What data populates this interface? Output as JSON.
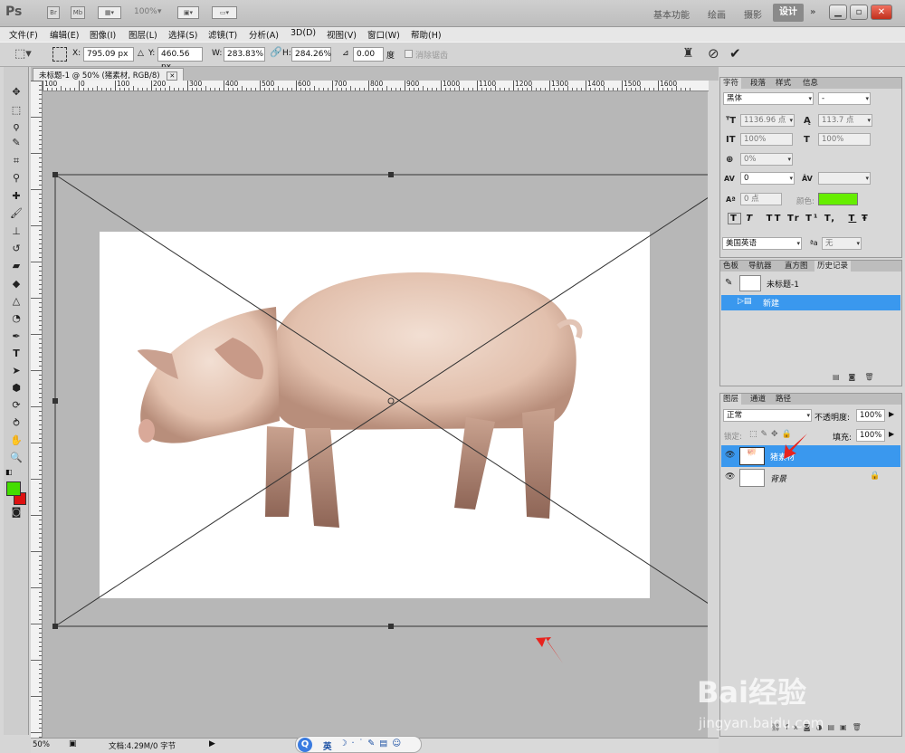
{
  "app": {
    "logo": "Ps",
    "zoom_display": "100%"
  },
  "workspaces": {
    "items": [
      "基本功能",
      "绘画",
      "摄影"
    ],
    "active": "设计",
    "more": "»"
  },
  "menu": [
    "文件(F)",
    "编辑(E)",
    "图像(I)",
    "图层(L)",
    "选择(S)",
    "滤镜(T)",
    "分析(A)",
    "3D(D)",
    "视图(V)",
    "窗口(W)",
    "帮助(H)"
  ],
  "options": {
    "x_label": "X:",
    "x_value": "795.09 px",
    "y_label": "Y:",
    "y_value": "460.56 px",
    "w_label": "W:",
    "w_value": "283.83%",
    "h_label": "H:",
    "h_value": "284.26%",
    "angle_value": "0.00",
    "angle_unit": "度",
    "antialias_label": "消除锯齿"
  },
  "document": {
    "tab_title": "未标题-1 @ 50% (猪素材, RGB/8)",
    "ruler_labels": [
      "100",
      "0",
      "100",
      "200",
      "300",
      "400",
      "500",
      "600",
      "700",
      "800",
      "900",
      "1000",
      "1100",
      "1200",
      "1300",
      "1400",
      "1500",
      "1600"
    ],
    "status_zoom": "50%",
    "status_info": "文档:4.29M/0 字节"
  },
  "character_panel": {
    "tabs": [
      "字符",
      "段落",
      "样式",
      "信息"
    ],
    "font_family": "黑体",
    "font_style": "-",
    "font_size": "1136.96 点",
    "leading": "113.7 点",
    "vertical_scale": "100%",
    "horizontal_scale": "100%",
    "kerning_percent": "0%",
    "tracking": "0",
    "baseline_shift": "0 点",
    "color_label": "颜色:",
    "color_value": "#66ee00",
    "language": "美国英语",
    "aa_label": "a",
    "aa_value": "无",
    "style_buttons": [
      "T",
      "T",
      "TT",
      "Tr",
      "T¹",
      "T,",
      "T",
      "Ŧ"
    ]
  },
  "history_panel": {
    "tabs": [
      "色板",
      "导航器",
      "直方图",
      "历史记录"
    ],
    "snapshot_label": "未标题-1",
    "items": [
      {
        "label": "新建",
        "selected": true
      }
    ]
  },
  "layers_panel": {
    "tabs": [
      "图层",
      "通道",
      "路径"
    ],
    "blend_mode": "正常",
    "opacity_label": "不透明度:",
    "opacity_value": "100%",
    "lock_label": "锁定:",
    "fill_label": "填充:",
    "fill_value": "100%",
    "layers": [
      {
        "name": "猪素材",
        "selected": true
      },
      {
        "name": "背景",
        "selected": false
      }
    ]
  },
  "colors": {
    "foreground": "#44dd00",
    "background": "#dd1111",
    "selection_blue": "#3a98ee",
    "annotation_red": "#e8231e"
  },
  "taskbar": {
    "ime": "英"
  },
  "watermark": {
    "text": "Bai经验",
    "url": "jingyan.baidu.com"
  }
}
